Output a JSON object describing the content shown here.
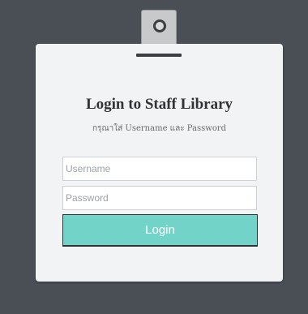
{
  "login": {
    "title": "Login to Staff Library",
    "subtitle": "กรุณาใส่ Username และ Password",
    "username_placeholder": "Username",
    "username_value": "",
    "password_placeholder": "Password",
    "password_value": "",
    "button_label": "Login"
  },
  "colors": {
    "background": "#4a4e55",
    "card": "#f2f3f4",
    "button": "#72d3c8",
    "button_text": "#ffffff"
  },
  "icons": {
    "clip": "clipboard-clip-icon"
  }
}
